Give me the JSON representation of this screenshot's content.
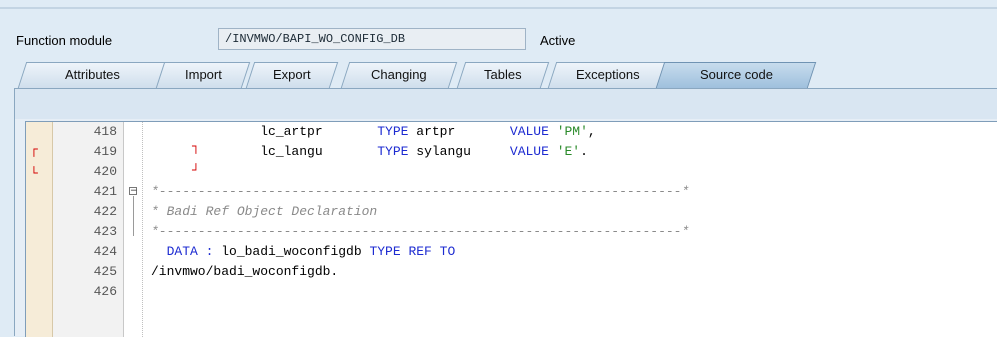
{
  "header": {
    "function_module_label": "Function module",
    "function_module_value": "/INVMWO/BAPI_WO_CONFIG_DB",
    "status": "Active"
  },
  "tabs": [
    {
      "label": "Attributes",
      "active": false
    },
    {
      "label": "Import",
      "active": false
    },
    {
      "label": "Export",
      "active": false
    },
    {
      "label": "Changing",
      "active": false
    },
    {
      "label": "Tables",
      "active": false
    },
    {
      "label": "Exceptions",
      "active": false
    },
    {
      "label": "Source code",
      "active": true
    }
  ],
  "code_lines": [
    {
      "no": "418",
      "p1": "              lc_artpr",
      "k1": "       TYPE",
      "p2": " artpr",
      "k2": "       VALUE",
      "s": " 'PM'",
      "p3": ","
    },
    {
      "no": "419",
      "p1": "              lc_langu",
      "k1": "       TYPE",
      "p2": " sylangu",
      "k2": "     VALUE",
      "s": " 'E'",
      "p3": "."
    },
    {
      "no": "420",
      "text": ""
    },
    {
      "no": "421",
      "comment": "*-------------------------------------------------------------------*"
    },
    {
      "no": "422",
      "comment": "* Badi Ref Object Declaration"
    },
    {
      "no": "423",
      "comment": "*-------------------------------------------------------------------*"
    },
    {
      "no": "424",
      "k1": "  DATA :",
      "p1": " lo_badi_woconfigdb ",
      "k2": "TYPE REF TO"
    },
    {
      "no": "425",
      "p1": "/invmwo/badi_woconfigdb."
    },
    {
      "no": "426",
      "text": ""
    }
  ],
  "colors": {
    "keyword": "#1d2bd1",
    "string": "#2a8a2a",
    "comment": "#8a8a8a",
    "marker": "#d40000"
  }
}
